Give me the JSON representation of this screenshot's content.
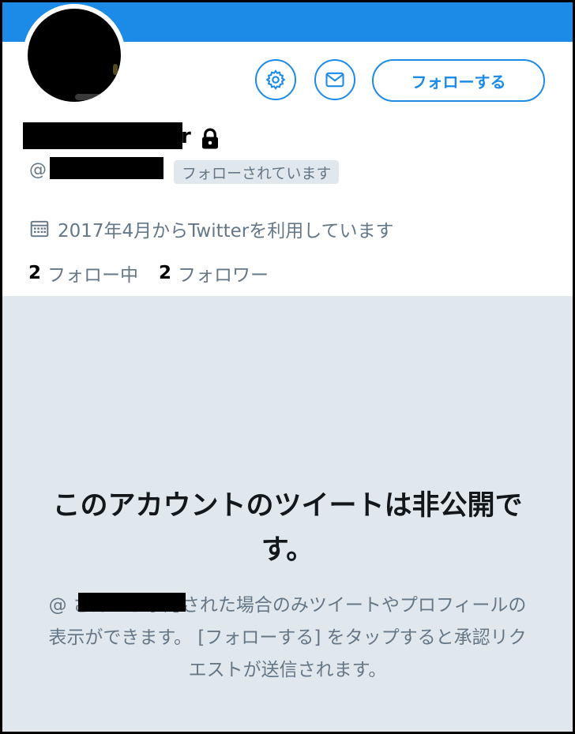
{
  "profile": {
    "name_visible_tail": "r",
    "handle_prefix": "@",
    "follows_you_label": "フォローされています",
    "joined_text": "2017年4月からTwitterを利用しています",
    "following_count": "2",
    "following_label": "フォロー中",
    "followers_count": "2",
    "followers_label": "フォロワー"
  },
  "actions": {
    "settings_icon": "gear-icon",
    "message_icon": "envelope-icon",
    "follow_label": "フォローする"
  },
  "protected": {
    "title": "このアカウントのツイートは非公開です。",
    "description": "@ さんから承認された場合のみツイートやプロフィールの表示ができます。 [フォローする] をタップすると承認リクエストが送信されます。"
  },
  "colors": {
    "accent": "#1b8be7",
    "muted_text": "#657786",
    "panel_bg": "#e1e8ed"
  }
}
